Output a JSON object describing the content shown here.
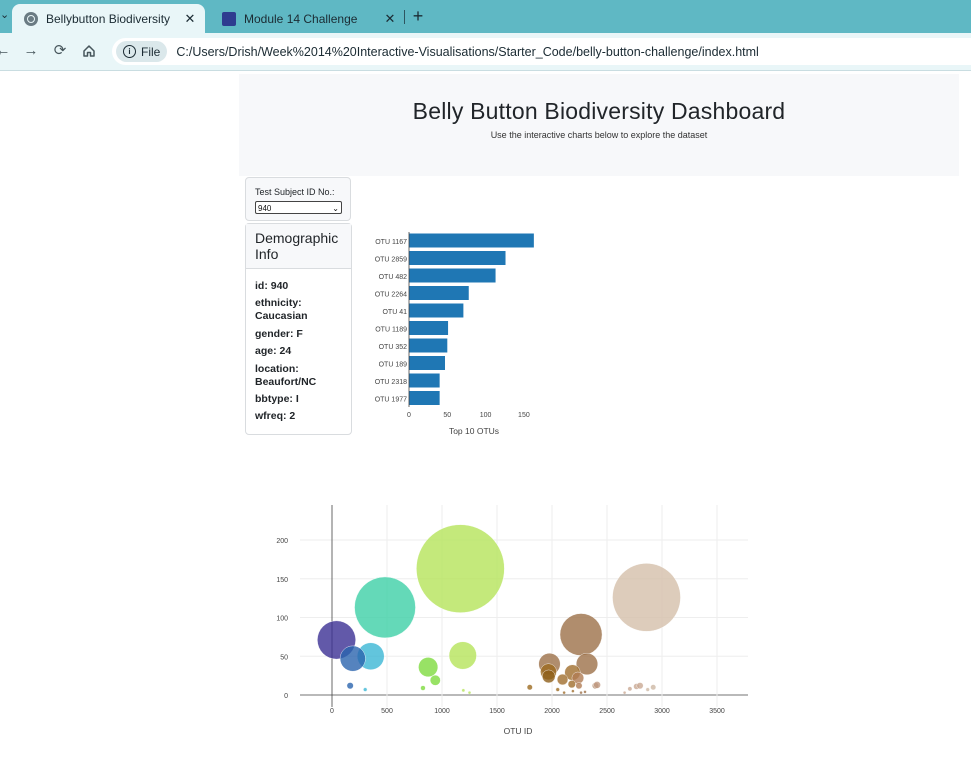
{
  "browser": {
    "active_tab": "Bellybutton Biodiversity",
    "inactive_tab": "Module 14 Challenge",
    "close_glyph": "✕",
    "new_tab_glyph": "+",
    "file_chip": "File",
    "url": "C:/Users/Drish/Week%2014%20Interactive-Visualisations/Starter_Code/belly-button-challenge/index.html"
  },
  "header": {
    "title": "Belly Button Biodiversity Dashboard",
    "subtitle": "Use the interactive charts below to explore the dataset"
  },
  "selector": {
    "label": "Test Subject ID No.:",
    "value": "940"
  },
  "demographics": {
    "title": "Demographic Info",
    "rows": [
      "id: 940",
      "ethnicity: Caucasian",
      "gender: F",
      "age: 24",
      "location: Beaufort/NC",
      "bbtype: I",
      "wfreq: 2"
    ]
  },
  "chart_data": [
    {
      "type": "bar",
      "orientation": "horizontal",
      "title": "Top 10 OTUs",
      "categories": [
        "OTU 1167",
        "OTU 2859",
        "OTU 482",
        "OTU 2264",
        "OTU 41",
        "OTU 1189",
        "OTU 352",
        "OTU 189",
        "OTU 2318",
        "OTU 1977"
      ],
      "values": [
        163,
        126,
        113,
        78,
        71,
        51,
        50,
        47,
        40,
        40
      ],
      "xticks": [
        "0",
        "50",
        "100",
        "150"
      ],
      "xlim": [
        0,
        163
      ],
      "color": "#1f77b4"
    },
    {
      "type": "scatter",
      "subtype": "bubble",
      "xlabel": "OTU ID",
      "xticks": [
        "0",
        "500",
        "1000",
        "1500",
        "2000",
        "2500",
        "3000",
        "3500"
      ],
      "yticks": [
        "0",
        "50",
        "100",
        "150",
        "200"
      ],
      "xlim": [
        -300,
        3800
      ],
      "ylim": [
        -5,
        230
      ],
      "grid": true,
      "points": [
        {
          "x": 1167,
          "y": 163,
          "c": "#b5e35a"
        },
        {
          "x": 2859,
          "y": 126,
          "c": "#d4bfaa"
        },
        {
          "x": 482,
          "y": 113,
          "c": "#3dcfa6"
        },
        {
          "x": 2264,
          "y": 78,
          "c": "#9c7048"
        },
        {
          "x": 41,
          "y": 71,
          "c": "#3b2f93"
        },
        {
          "x": 1189,
          "y": 51,
          "c": "#b5e35a"
        },
        {
          "x": 352,
          "y": 50,
          "c": "#3bb6d5"
        },
        {
          "x": 189,
          "y": 47,
          "c": "#2b64ae"
        },
        {
          "x": 2318,
          "y": 40,
          "c": "#9c7048"
        },
        {
          "x": 1977,
          "y": 40,
          "c": "#9c7048"
        },
        {
          "x": 874,
          "y": 36,
          "c": "#7edb3e"
        },
        {
          "x": 1968,
          "y": 30,
          "c": "#9c6a1f"
        },
        {
          "x": 2186,
          "y": 29,
          "c": "#a06e2d"
        },
        {
          "x": 1970,
          "y": 24,
          "c": "#8d5e18"
        },
        {
          "x": 2096,
          "y": 20,
          "c": "#a06e2d"
        },
        {
          "x": 2235,
          "y": 22,
          "c": "#b07c54"
        },
        {
          "x": 2180,
          "y": 14,
          "c": "#a06e2d"
        },
        {
          "x": 2245,
          "y": 12,
          "c": "#b07c54"
        },
        {
          "x": 939,
          "y": 19,
          "c": "#7edb3e"
        },
        {
          "x": 2395,
          "y": 12,
          "c": "#b59072"
        },
        {
          "x": 2410,
          "y": 13,
          "c": "#c19a82"
        },
        {
          "x": 2768,
          "y": 11,
          "c": "#c9a993"
        },
        {
          "x": 2800,
          "y": 12,
          "c": "#c9a993"
        },
        {
          "x": 2920,
          "y": 10,
          "c": "#cdb8a4"
        },
        {
          "x": 1798,
          "y": 10,
          "c": "#9c6a1f"
        },
        {
          "x": 165,
          "y": 12,
          "c": "#2b64ae"
        },
        {
          "x": 827,
          "y": 9,
          "c": "#7edb3e"
        },
        {
          "x": 2708,
          "y": 8,
          "c": "#c9a993"
        },
        {
          "x": 2870,
          "y": 7,
          "c": "#cdb8a4"
        },
        {
          "x": 2052,
          "y": 7,
          "c": "#9c6a1f"
        },
        {
          "x": 302,
          "y": 7,
          "c": "#3bb6d5"
        },
        {
          "x": 1194,
          "y": 6,
          "c": "#b5e35a"
        },
        {
          "x": 2264,
          "y": 3,
          "c": "#9c7048"
        },
        {
          "x": 2300,
          "y": 4,
          "c": "#9c7048"
        },
        {
          "x": 2190,
          "y": 5,
          "c": "#a06e2d"
        },
        {
          "x": 2110,
          "y": 3,
          "c": "#a06e2d"
        },
        {
          "x": 1250,
          "y": 3,
          "c": "#b5e35a"
        },
        {
          "x": 2660,
          "y": 3,
          "c": "#c9a993"
        }
      ]
    }
  ]
}
